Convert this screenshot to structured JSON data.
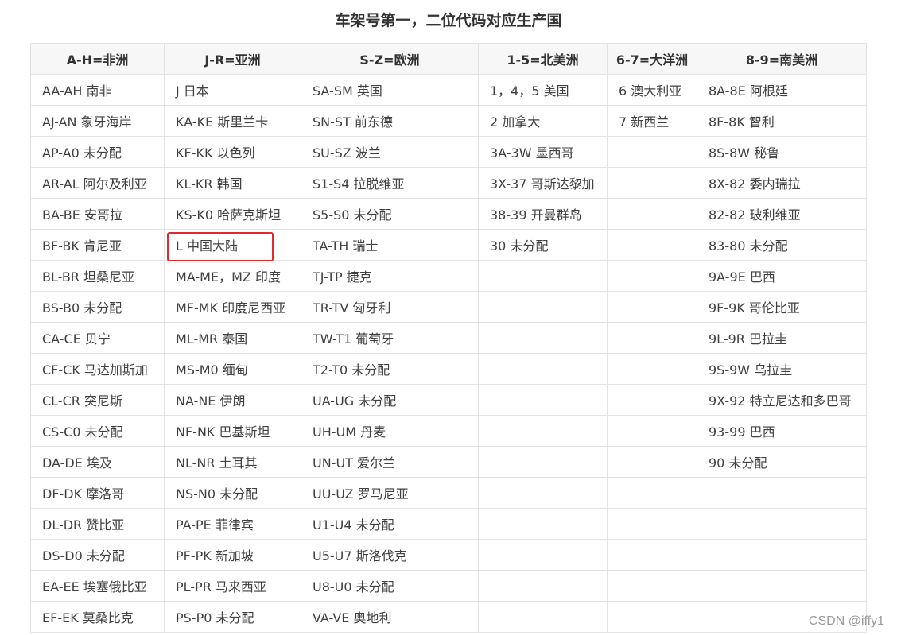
{
  "title": "车架号第一，二位代码对应生产国",
  "headers": [
    "A-H=非洲",
    "J-R=亚洲",
    "S-Z=欧洲",
    "1-5=北美洲",
    "6-7=大洋洲",
    "8-9=南美洲"
  ],
  "rows": [
    [
      "AA-AH 南非",
      "J 日本",
      "SA-SM 英国",
      "1，4，5 美国",
      "6 澳大利亚",
      "8A-8E 阿根廷"
    ],
    [
      "AJ-AN 象牙海岸",
      "KA-KE 斯里兰卡",
      "SN-ST 前东德",
      "2 加拿大",
      "7 新西兰",
      "8F-8K 智利"
    ],
    [
      "AP-A0 未分配",
      "KF-KK 以色列",
      "SU-SZ 波兰",
      "3A-3W 墨西哥",
      "",
      "8S-8W 秘鲁"
    ],
    [
      "AR-AL 阿尔及利亚",
      "KL-KR 韩国",
      "S1-S4 拉脱维亚",
      "3X-37 哥斯达黎加",
      "",
      "8X-82 委内瑞拉"
    ],
    [
      "BA-BE 安哥拉",
      "KS-K0 哈萨克斯坦",
      "S5-S0 未分配",
      "38-39 开曼群岛",
      "",
      "82-82 玻利维亚"
    ],
    [
      "BF-BK 肯尼亚",
      "L 中国大陆",
      "TA-TH 瑞士",
      "30 未分配",
      "",
      "83-80 未分配"
    ],
    [
      "BL-BR 坦桑尼亚",
      "MA-ME，MZ 印度",
      "TJ-TP 捷克",
      "",
      "",
      "9A-9E 巴西"
    ],
    [
      "BS-B0 未分配",
      "MF-MK 印度尼西亚",
      "TR-TV 匈牙利",
      "",
      "",
      "9F-9K 哥伦比亚"
    ],
    [
      "CA-CE 贝宁",
      "ML-MR 泰国",
      "TW-T1 葡萄牙",
      "",
      "",
      "9L-9R 巴拉圭"
    ],
    [
      "CF-CK 马达加斯加",
      "MS-M0 缅甸",
      "T2-T0 未分配",
      "",
      "",
      "9S-9W 乌拉圭"
    ],
    [
      "CL-CR 突尼斯",
      "NA-NE 伊朗",
      "UA-UG 未分配",
      "",
      "",
      "9X-92 特立尼达和多巴哥"
    ],
    [
      "CS-C0 未分配",
      "NF-NK 巴基斯坦",
      "UH-UM 丹麦",
      "",
      "",
      "93-99 巴西"
    ],
    [
      "DA-DE 埃及",
      "NL-NR 土耳其",
      "UN-UT 爱尔兰",
      "",
      "",
      "90 未分配"
    ],
    [
      "DF-DK 摩洛哥",
      "NS-N0 未分配",
      "UU-UZ 罗马尼亚",
      "",
      "",
      ""
    ],
    [
      "DL-DR 赞比亚",
      "PA-PE 菲律宾",
      "U1-U4 未分配",
      "",
      "",
      ""
    ],
    [
      "DS-D0 未分配",
      "PF-PK 新加坡",
      "U5-U7 斯洛伐克",
      "",
      "",
      ""
    ],
    [
      "EA-EE 埃塞俄比亚",
      "PL-PR 马来西亚",
      "U8-U0 未分配",
      "",
      "",
      ""
    ],
    [
      "EF-EK 莫桑比克",
      "PS-P0 未分配",
      "VA-VE 奥地利",
      "",
      "",
      ""
    ]
  ],
  "highlighted_cell": "L 中国大陆",
  "watermark": "CSDN @iffy1",
  "colors": {
    "highlight_border": "#e02b2b",
    "header_bg": "#f7f7f7",
    "grid": "#e3e3e3"
  }
}
